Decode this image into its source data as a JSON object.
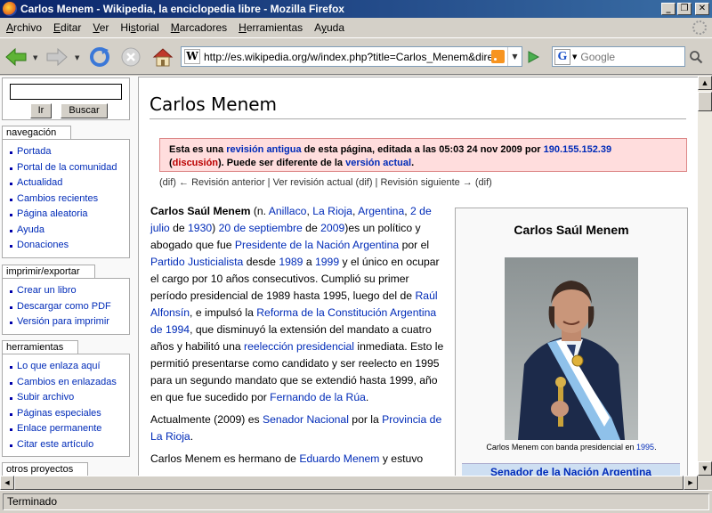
{
  "window": {
    "title": "Carlos Menem - Wikipedia, la enciclopedia libre - Mozilla Firefox",
    "minimize": "_",
    "restore": "❐",
    "close": "✕"
  },
  "menu": [
    "Archivo",
    "Editar",
    "Ver",
    "Historial",
    "Marcadores",
    "Herramientas",
    "Ayuda"
  ],
  "menu_access_keys": [
    "A",
    "E",
    "V",
    "s",
    "M",
    "H",
    "y"
  ],
  "navbar": {
    "url": "http://es.wikipedia.org/w/index.php?title=Carlos_Menem&direction",
    "favicon": "W",
    "search_engine_letter": "G",
    "search_placeholder": "Google"
  },
  "sidebar": {
    "search_go": "Ir",
    "search_button": "Buscar",
    "portlets": [
      {
        "title": "navegación",
        "items": [
          "Portada",
          "Portal de la comunidad",
          "Actualidad",
          "Cambios recientes",
          "Página aleatoria",
          "Ayuda",
          "Donaciones"
        ]
      },
      {
        "title": "imprimir/exportar",
        "items": [
          "Crear un libro",
          "Descargar como PDF",
          "Versión para imprimir"
        ]
      },
      {
        "title": "herramientas",
        "items": [
          "Lo que enlaza aquí",
          "Cambios en enlazadas",
          "Subir archivo",
          "Páginas especiales",
          "Enlace permanente",
          "Citar este artículo"
        ]
      },
      {
        "title": "otros proyectos",
        "items": []
      }
    ]
  },
  "article": {
    "heading": "Carlos Menem",
    "oldrev": {
      "t1": "Esta es una ",
      "l1": "revisión antigua",
      "t2": " de esta página, editada a las 05:03 24 nov 2009 por ",
      "l2": "190.155.152.39",
      "t3": "(",
      "l3": "discusión",
      "t4": "). Puede ser diferente de la ",
      "l4": "versión actual",
      "t5": "."
    },
    "diffnav": {
      "dif1": "(dif)",
      "prev": " ← Revisión anterior",
      "sep1": " | ",
      "current": "Ver revisión actual",
      "dif2": " (dif)",
      "sep2": " | ",
      "next": "Revisión siguiente →",
      "dif3": " (dif)"
    },
    "p1": [
      {
        "t": "Carlos Saúl Menem",
        "b": true
      },
      {
        "t": " (n. "
      },
      {
        "t": "Anillaco",
        "l": true
      },
      {
        "t": ", "
      },
      {
        "t": "La Rioja",
        "l": true
      },
      {
        "t": ", "
      },
      {
        "t": "Argentina",
        "l": true
      },
      {
        "t": ", "
      },
      {
        "t": "2 de julio",
        "l": true
      },
      {
        "t": " de "
      },
      {
        "t": "1930",
        "l": true
      },
      {
        "t": ") "
      },
      {
        "t": "20 de septiembre",
        "l": true
      },
      {
        "t": " de "
      },
      {
        "t": "2009",
        "l": true
      },
      {
        "t": ")es un político y abogado que fue "
      },
      {
        "t": "Presidente de la Nación Argentina",
        "l": true
      },
      {
        "t": " por el "
      },
      {
        "t": "Partido Justicialista",
        "l": true
      },
      {
        "t": " desde "
      },
      {
        "t": "1989",
        "l": true
      },
      {
        "t": " a "
      },
      {
        "t": "1999",
        "l": true
      },
      {
        "t": " y el único en ocupar el cargo por 10 años consecutivos. Cumplió su primer período presidencial de 1989 hasta 1995, luego del de "
      },
      {
        "t": "Raúl Alfonsín",
        "l": true
      },
      {
        "t": ", e impulsó la "
      },
      {
        "t": "Reforma de la Constitución Argentina de 1994",
        "l": true
      },
      {
        "t": ", que disminuyó la extensión del mandato a cuatro años y habilitó una "
      },
      {
        "t": "reelección presidencial",
        "l": true
      },
      {
        "t": " inmediata. Esto le permitió presentarse como candidato y ser reelecto en 1995 para un segundo mandato que se extendió hasta 1999, año en que fue sucedido por "
      },
      {
        "t": "Fernando de la Rúa",
        "l": true
      },
      {
        "t": "."
      }
    ],
    "p2": [
      {
        "t": "Actualmente (2009) es "
      },
      {
        "t": "Senador Nacional",
        "l": true
      },
      {
        "t": " por la "
      },
      {
        "t": "Provincia de La Rioja",
        "l": true
      },
      {
        "t": "."
      }
    ],
    "p3": [
      {
        "t": "Carlos Menem es hermano de "
      },
      {
        "t": "Eduardo Menem",
        "l": true
      },
      {
        "t": " y estuvo"
      }
    ]
  },
  "infobox": {
    "title": "Carlos Saúl Menem",
    "caption_text": "Carlos Menem con banda presidencial en ",
    "caption_link": "1995",
    "caption_end": ".",
    "section": "Senador de la Nación Argentina"
  },
  "status": "Terminado",
  "colors": {
    "link": "#002bb8",
    "newlink": "#ba0000",
    "oldrev_bg": "#ffdddd",
    "titlebar": "#0a246a"
  }
}
